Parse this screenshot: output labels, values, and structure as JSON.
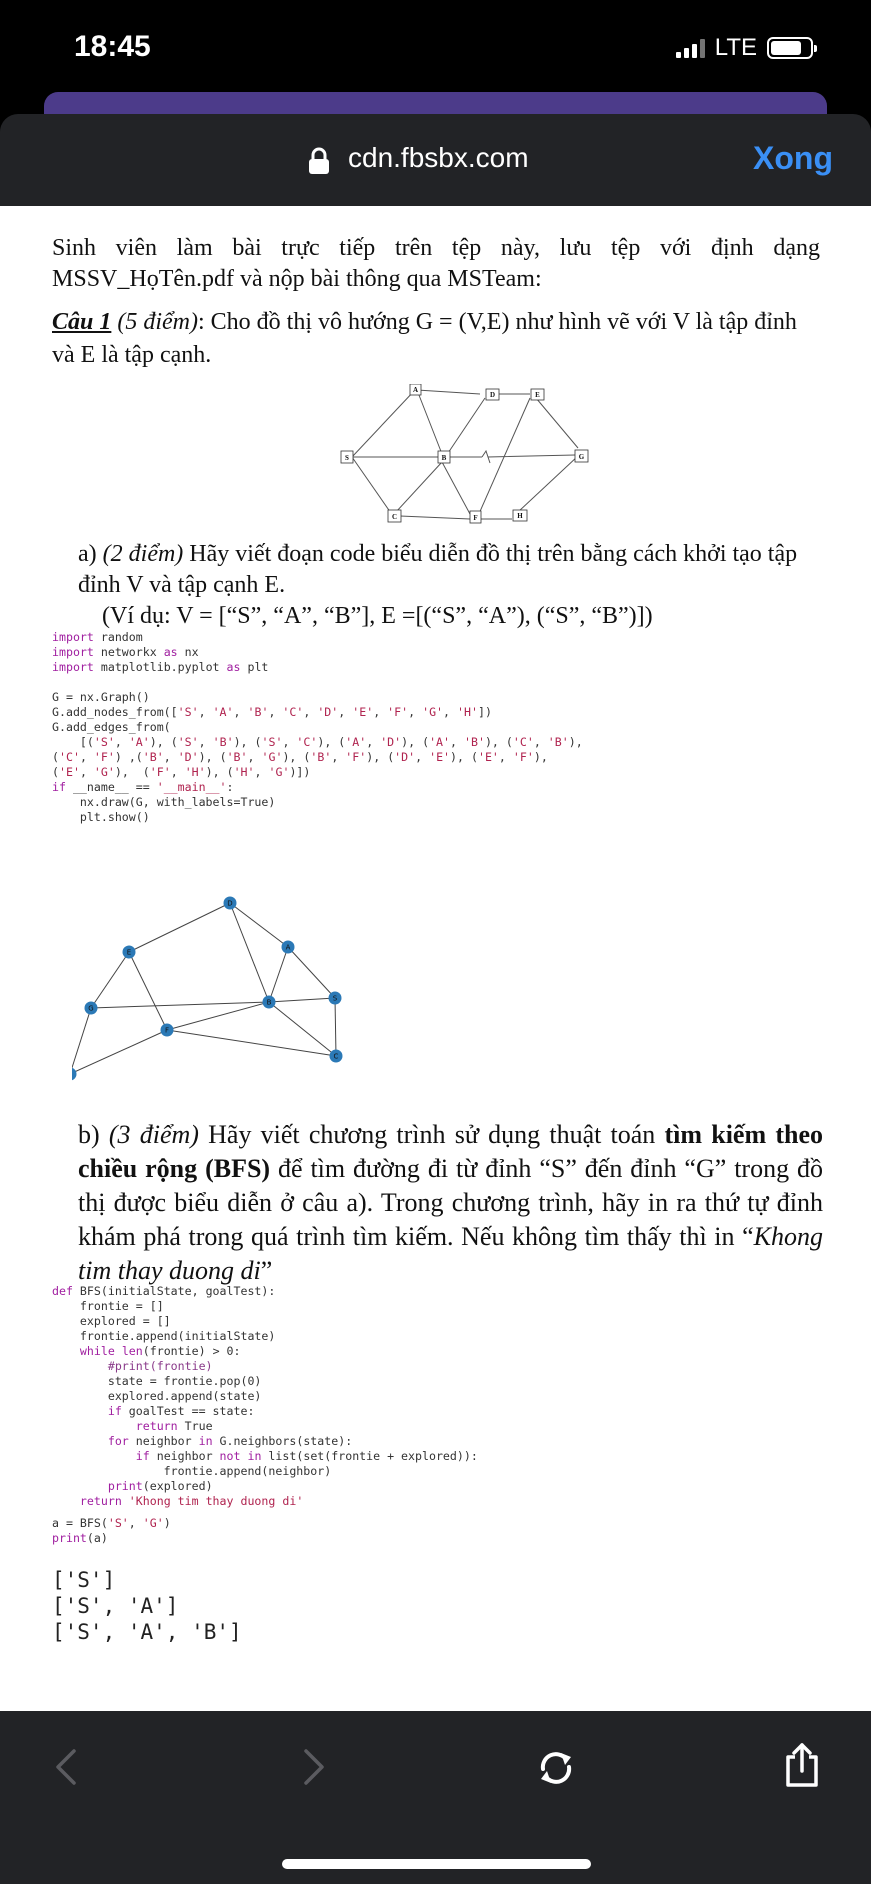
{
  "status_bar": {
    "time": "18:45",
    "network": "LTE"
  },
  "header": {
    "url": "cdn.fbsbx.com",
    "done_label": "Xong"
  },
  "document": {
    "intro": "Sinh viên làm bài trực tiếp trên tệp này, lưu tệp với định dạng MSSV_HọTên.pdf và nộp bài thông qua MSTeam:",
    "q1_title": "Câu 1",
    "q1_points": "(5 điểm)",
    "q1_text": ": Cho đồ thị vô hướng G = (V,E) như hình vẽ với V là tập đỉnh và E là tập cạnh.",
    "diagram_nodes": [
      "A",
      "D",
      "E",
      "S",
      "B",
      "G",
      "C",
      "F",
      "H"
    ],
    "qa_prefix": "a)",
    "qa_points": "(2 điểm)",
    "qa_text": "Hãy viết đoạn code biểu diễn đồ thị trên bằng cách khởi tạo tập đỉnh V và tập cạnh E.",
    "qa_example": "(Ví dụ: V = [“S”, “A”, “B”], E =[(“S”, “A”), (“S”, “B”)])",
    "code_lines_1": [
      "import random",
      "import networkx as nx",
      "import matplotlib.pyplot as plt",
      "",
      "G = nx.Graph()",
      "G.add_nodes_from(['S', 'A', 'B', 'C', 'D', 'E', 'F', 'G', 'H'])",
      "G.add_edges_from(",
      "    [('S', 'A'), ('S', 'B'), ('S', 'C'), ('A', 'D'), ('A', 'B'), ('C', 'B'),",
      "('C', 'F') ,('B', 'D'), ('B', 'G'), ('B', 'F'), ('D', 'E'), ('E', 'F'),",
      "('E', 'G'),  ('F', 'H'), ('H', 'G')])",
      "if __name__ == '__main__':",
      "    nx.draw(G, with_labels=True)",
      "    plt.show()"
    ],
    "plot_nodes": [
      "D",
      "A",
      "E",
      "B",
      "S",
      "G",
      "F",
      "C",
      "H"
    ],
    "qb_prefix": "b)",
    "qb_points": "(3 điểm)",
    "qb_text_1": "Hãy viết chương trình sử dụng thuật toán ",
    "qb_bold": "tìm kiếm theo chiều rộng (BFS)",
    "qb_text_2": " để tìm đường đi từ đỉnh “S” đến đỉnh “G” trong đồ thị được biểu diễn ở câu a). Trong chương trình, hãy in ra thứ tự đỉnh khám phá trong quá trình tìm kiếm. Nếu không tìm thấy thì in “",
    "qb_italic": "Khong tim thay duong di",
    "qb_end": "”",
    "code_lines_2": [
      "def BFS(initialState, goalTest):",
      "    frontie = []",
      "    explored = []",
      "    frontie.append(initialState)",
      "    while len(frontie) > 0:",
      "        #print(frontie)",
      "        state = frontie.pop(0)",
      "        explored.append(state)",
      "        if goalTest == state:",
      "            return True",
      "        for neighbor in G.neighbors(state):",
      "            if neighbor not in list(set(frontie + explored)):",
      "                frontie.append(neighbor)",
      "        print(explored)",
      "    return 'Khong tim thay duong di'"
    ],
    "code_lines_3": [
      "a = BFS('S', 'G')",
      "print(a)"
    ],
    "output_lines": [
      "['S']",
      "['S', 'A']",
      "['S', 'A', 'B']"
    ]
  }
}
